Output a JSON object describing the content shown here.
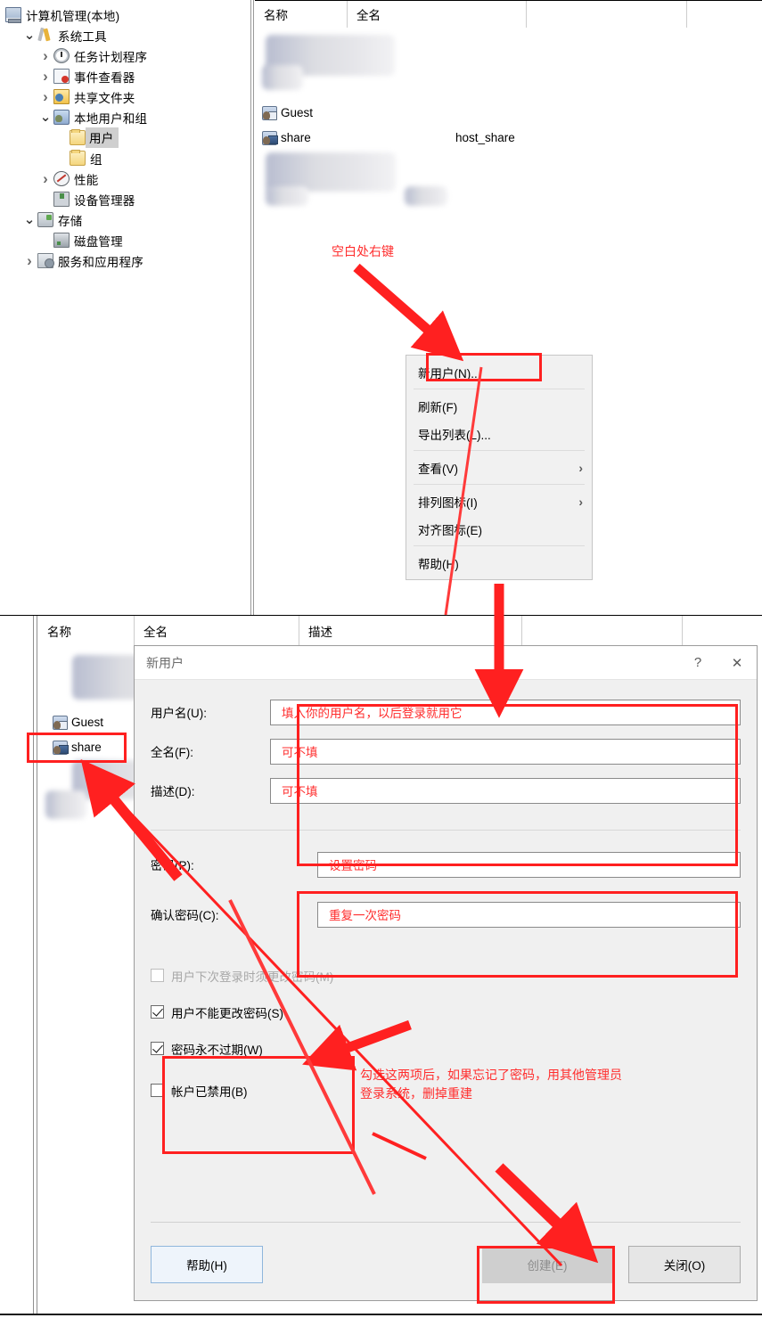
{
  "tree": {
    "root": {
      "label": "计算机管理(本地)",
      "icon": "computer-icon"
    },
    "items": [
      {
        "label": "系统工具",
        "icon": "tools-icon",
        "twisty": "open",
        "indent": 1
      },
      {
        "label": "任务计划程序",
        "icon": "clock-icon",
        "twisty": "collapsed",
        "indent": 2
      },
      {
        "label": "事件查看器",
        "icon": "event-viewer-icon",
        "twisty": "collapsed",
        "indent": 2
      },
      {
        "label": "共享文件夹",
        "icon": "shared-folder-icon",
        "twisty": "collapsed",
        "indent": 2
      },
      {
        "label": "本地用户和组",
        "icon": "local-users-icon",
        "twisty": "open",
        "indent": 2
      },
      {
        "label": "用户",
        "icon": "folder-icon",
        "twisty": "none",
        "indent": 3,
        "selected": true
      },
      {
        "label": "组",
        "icon": "folder-icon",
        "twisty": "none",
        "indent": 3
      },
      {
        "label": "性能",
        "icon": "performance-icon",
        "twisty": "collapsed",
        "indent": 2
      },
      {
        "label": "设备管理器",
        "icon": "device-manager-icon",
        "twisty": "none",
        "indent": 2
      },
      {
        "label": "存储",
        "icon": "storage-icon",
        "twisty": "open",
        "indent": 1
      },
      {
        "label": "磁盘管理",
        "icon": "disk-management-icon",
        "twisty": "none",
        "indent": 2
      },
      {
        "label": "服务和应用程序",
        "icon": "services-icon",
        "twisty": "collapsed",
        "indent": 1
      }
    ]
  },
  "top_list": {
    "columns": [
      "名称",
      "全名",
      ""
    ],
    "rows": [
      {
        "name": "",
        "fullname": "",
        "redacted": true
      },
      {
        "name": "Guest",
        "fullname": "",
        "icon": "user-guest-icon"
      },
      {
        "name": "share",
        "fullname": "host_share",
        "icon": "user-icon"
      },
      {
        "name": "",
        "fullname": "",
        "redacted": true
      }
    ]
  },
  "context_menu": {
    "items": [
      {
        "label": "新用户(N)...",
        "submenu": false,
        "highlighted": true
      },
      {
        "separator": true
      },
      {
        "label": "刷新(F)",
        "submenu": false
      },
      {
        "label": "导出列表(L)...",
        "submenu": false
      },
      {
        "separator": true
      },
      {
        "label": "查看(V)",
        "submenu": true,
        "arrow": "›"
      },
      {
        "separator": true
      },
      {
        "label": "排列图标(I)",
        "submenu": true,
        "arrow": "›"
      },
      {
        "label": "对齐图标(E)",
        "submenu": false
      },
      {
        "separator": true
      },
      {
        "label": "帮助(H)",
        "submenu": false
      }
    ]
  },
  "bottom_list": {
    "columns": [
      "名称",
      "全名",
      "描述",
      ""
    ],
    "rows": [
      {
        "name": "",
        "redacted": true
      },
      {
        "name": "Guest",
        "icon": "user-guest-icon"
      },
      {
        "name": "share",
        "icon": "user-icon",
        "highlighted": true
      },
      {
        "name": "",
        "redacted": true
      }
    ]
  },
  "dialog": {
    "title": "新用户",
    "help_button": "?",
    "close_button": "✕",
    "fields": [
      {
        "label": "用户名(U):",
        "hint": "填入你的用户名，以后登录就用它"
      },
      {
        "label": "全名(F):",
        "hint": "可不填"
      },
      {
        "label": "描述(D):",
        "hint": "可不填"
      }
    ],
    "password_fields": [
      {
        "label": "密码(P):",
        "hint": "设置密码"
      },
      {
        "label": "确认密码(C):",
        "hint": "重复一次密码"
      }
    ],
    "checkboxes": [
      {
        "label": "用户下次登录时须更改密码(M)",
        "checked": false,
        "disabled": true
      },
      {
        "label": "用户不能更改密码(S)",
        "checked": true,
        "disabled": false
      },
      {
        "label": "密码永不过期(W)",
        "checked": true,
        "disabled": false
      },
      {
        "label": "帐户已禁用(B)",
        "checked": false,
        "disabled": false
      }
    ],
    "buttons": {
      "help": "帮助(H)",
      "create": "创建(E)",
      "close": "关闭(O)"
    }
  },
  "annotations": {
    "right_click_blank": "空白处右键",
    "checkbox_note": "勾选这两项后，如果忘记了密码，用其他管理员\n登录系统，删掉重建"
  },
  "colors": {
    "annotation_red": "#ff2d2d",
    "window_bg": "#f0f0f0",
    "selection_gray": "#cfcfcf"
  }
}
